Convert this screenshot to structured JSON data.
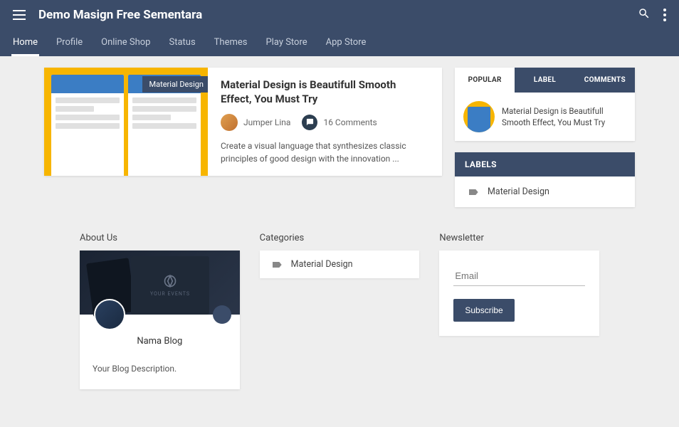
{
  "header": {
    "title": "Demo Masign Free Sementara"
  },
  "nav": [
    {
      "label": "Home",
      "active": true
    },
    {
      "label": "Profile",
      "active": false
    },
    {
      "label": "Online Shop",
      "active": false
    },
    {
      "label": "Status",
      "active": false
    },
    {
      "label": "Themes",
      "active": false
    },
    {
      "label": "Play Store",
      "active": false
    },
    {
      "label": "App Store",
      "active": false
    }
  ],
  "post": {
    "tag": "Material Design",
    "title": "Material Design is Beautifull Smooth Effect, You Must Try",
    "author": "Jumper Lina",
    "comments": "16 Comments",
    "excerpt": "Create a visual language that synthesizes classic principles of good design with the innovation ..."
  },
  "sidebar": {
    "tabs": [
      {
        "label": "POPULAR",
        "active": true
      },
      {
        "label": "LABEL",
        "active": false
      },
      {
        "label": "COMMENTS",
        "active": false
      }
    ],
    "popular": [
      {
        "title": "Material Design is Beautifull Smooth Effect, You Must Try"
      }
    ],
    "labels_header": "LABELS",
    "labels": [
      {
        "name": "Material Design"
      }
    ]
  },
  "footer": {
    "about": {
      "heading": "About Us",
      "banner_text": "YOUR EVENTS",
      "name": "Nama Blog",
      "desc": "Your Blog Description."
    },
    "categories": {
      "heading": "Categories",
      "items": [
        {
          "name": "Material Design"
        }
      ]
    },
    "newsletter": {
      "heading": "Newsletter",
      "placeholder": "Email",
      "button": "Subscribe"
    }
  }
}
